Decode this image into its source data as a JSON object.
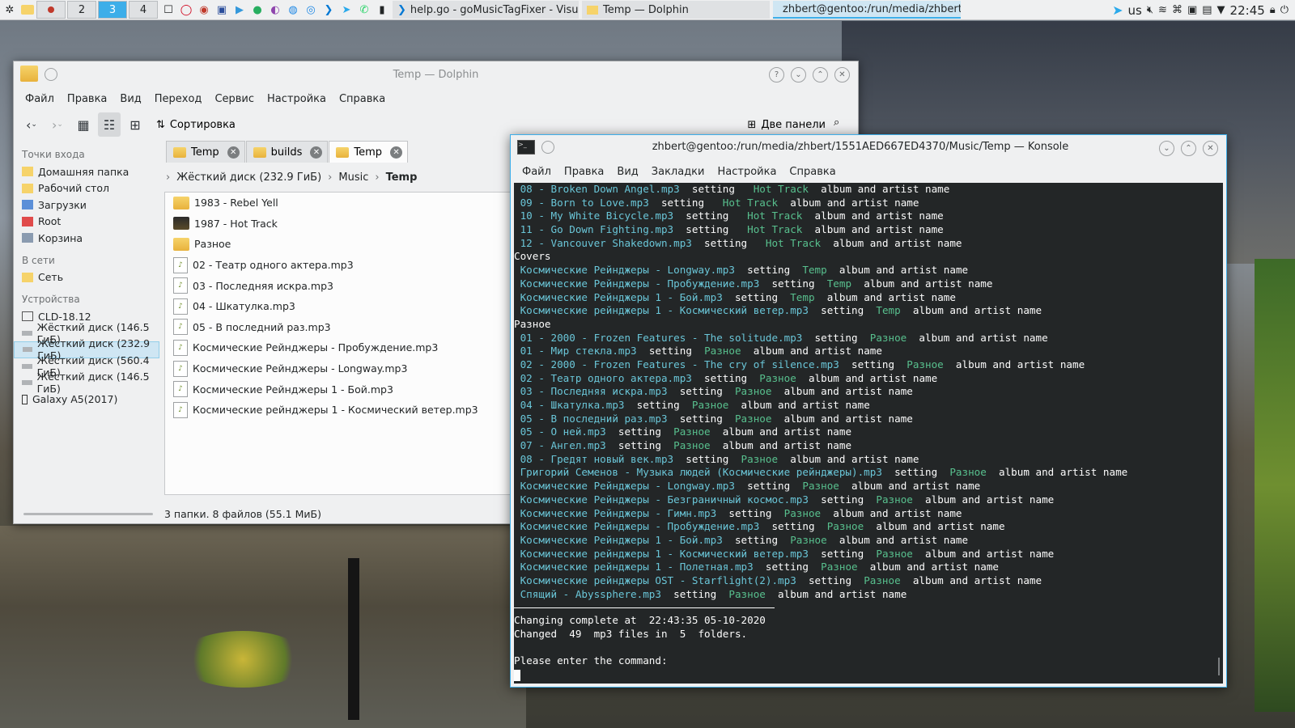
{
  "taskbar": {
    "pager": [
      "2",
      "3",
      "4"
    ],
    "tasks": [
      {
        "label": "help.go - goMusicTagFixer - Visual ...",
        "state": "dim"
      },
      {
        "label": "Temp — Dolphin",
        "state": "dim"
      },
      {
        "label": "zhbert@gentoo:/run/media/zhbert...",
        "state": "active"
      }
    ],
    "layout": "us",
    "clock": "22:45"
  },
  "dolphin": {
    "title": "Temp — Dolphin",
    "menu": [
      "Файл",
      "Правка",
      "Вид",
      "Переход",
      "Сервис",
      "Настройка",
      "Справка"
    ],
    "sort_label": "Сортировка",
    "panels_label": "Две панели",
    "places": {
      "entry_header": "Точки входа",
      "entries": [
        "Домашняя папка",
        "Рабочий стол",
        "Загрузки",
        "Root",
        "Корзина"
      ],
      "net_header": "В сети",
      "net": [
        "Сеть"
      ],
      "dev_header": "Устройства",
      "devices": [
        "CLD-18.12",
        "Жёсткий диск (146.5 ГиБ)",
        "Жёсткий диск (232.9 ГиБ)",
        "Жёсткий диск (560.4 ГиБ)",
        "Жёсткий диск (146.5 ГиБ)",
        "Galaxy A5(2017)"
      ]
    },
    "tabs": [
      "Temp",
      "builds",
      "Temp"
    ],
    "breadcrumb": [
      "Жёсткий диск (232.9 ГиБ)",
      "Music",
      "Temp"
    ],
    "files": [
      {
        "name": "1983 - Rebel Yell",
        "type": "folder"
      },
      {
        "name": "1987 - Hot Track",
        "type": "folder-cover"
      },
      {
        "name": "Разное",
        "type": "folder"
      },
      {
        "name": "02 - Театр одного актера.mp3",
        "type": "mp3"
      },
      {
        "name": "03 - Последняя искра.mp3",
        "type": "mp3"
      },
      {
        "name": "04 - Шкатулка.mp3",
        "type": "mp3"
      },
      {
        "name": "05 - В последний раз.mp3",
        "type": "mp3"
      },
      {
        "name": "Космические Рейнджеры - Пробуждение.mp3",
        "type": "mp3"
      },
      {
        "name": "Космические Рейнджеры - Longway.mp3",
        "type": "mp3"
      },
      {
        "name": "Космические Рейнджеры 1 - Бой.mp3",
        "type": "mp3"
      },
      {
        "name": "Космические рейнджеры 1 - Космический ветер.mp3",
        "type": "mp3"
      }
    ],
    "status": "3 папки. 8 файлов (55.1 МиБ)"
  },
  "konsole": {
    "title": "zhbert@gentoo:/run/media/zhbert/1551AED667ED4370/Music/Temp — Konsole",
    "menu": [
      "Файл",
      "Правка",
      "Вид",
      "Закладки",
      "Настройка",
      "Справка"
    ],
    "lines": [
      {
        "file": " 08 - Broken Down Angel.mp3",
        "mid": "  setting  ",
        "album": " Hot Track",
        "tail": "  album and artist name"
      },
      {
        "file": " 09 - Born to Love.mp3",
        "mid": "  setting  ",
        "album": " Hot Track",
        "tail": "  album and artist name"
      },
      {
        "file": " 10 - My White Bicycle.mp3",
        "mid": "  setting  ",
        "album": " Hot Track",
        "tail": "  album and artist name"
      },
      {
        "file": " 11 - Go Down Fighting.mp3",
        "mid": "  setting  ",
        "album": " Hot Track",
        "tail": "  album and artist name"
      },
      {
        "file": " 12 - Vancouver Shakedown.mp3",
        "mid": "  setting  ",
        "album": " Hot Track",
        "tail": "  album and artist name"
      },
      {
        "plain": "Covers"
      },
      {
        "file": " Космические Рейнджеры - Longway.mp3",
        "mid": "  setting  ",
        "album": "Temp",
        "tail": "  album and artist name"
      },
      {
        "file": " Космические Рейнджеры - Пробуждение.mp3",
        "mid": "  setting  ",
        "album": "Temp",
        "tail": "  album and artist name"
      },
      {
        "file": " Космические Рейнджеры 1 - Бой.mp3",
        "mid": "  setting  ",
        "album": "Temp",
        "tail": "  album and artist name"
      },
      {
        "file": " Космические рейнджеры 1 - Космический ветер.mp3",
        "mid": "  setting  ",
        "album": "Temp",
        "tail": "  album and artist name"
      },
      {
        "plain": "Разное"
      },
      {
        "file": " 01 - 2000 - Frozen Features - The solitude.mp3",
        "mid": "  setting  ",
        "album": "Разное",
        "tail": "  album and artist name"
      },
      {
        "file": " 01 - Мир стекла.mp3",
        "mid": "  setting  ",
        "album": "Разное",
        "tail": "  album and artist name"
      },
      {
        "file": " 02 - 2000 - Frozen Features - The cry of silence.mp3",
        "mid": "  setting  ",
        "album": "Разное",
        "tail": "  album and artist name"
      },
      {
        "file": " 02 - Театр одного актера.mp3",
        "mid": "  setting  ",
        "album": "Разное",
        "tail": "  album and artist name"
      },
      {
        "file": " 03 - Последняя искра.mp3",
        "mid": "  setting  ",
        "album": "Разное",
        "tail": "  album and artist name"
      },
      {
        "file": " 04 - Шкатулка.mp3",
        "mid": "  setting  ",
        "album": "Разное",
        "tail": "  album and artist name"
      },
      {
        "file": " 05 - В последний раз.mp3",
        "mid": "  setting  ",
        "album": "Разное",
        "tail": "  album and artist name"
      },
      {
        "file": " 05 - О ней.mp3",
        "mid": "  setting  ",
        "album": "Разное",
        "tail": "  album and artist name"
      },
      {
        "file": " 07 - Ангел.mp3",
        "mid": "  setting  ",
        "album": "Разное",
        "tail": "  album and artist name"
      },
      {
        "file": " 08 - Гредят новый век.mp3",
        "mid": "  setting  ",
        "album": "Разное",
        "tail": "  album and artist name"
      },
      {
        "file": " Григорий Семенов - Музыка людей (Космические рейнджеры).mp3",
        "mid": "  setting  ",
        "album": "Разное",
        "tail": "  album and artist name"
      },
      {
        "file": " Космические Рейнджеры - Longway.mp3",
        "mid": "  setting  ",
        "album": "Разное",
        "tail": "  album and artist name"
      },
      {
        "file": " Космические Рейнджеры - Безграничный космос.mp3",
        "mid": "  setting  ",
        "album": "Разное",
        "tail": "  album and artist name"
      },
      {
        "file": " Космические Рейнджеры - Гимн.mp3",
        "mid": "  setting  ",
        "album": "Разное",
        "tail": "  album and artist name"
      },
      {
        "file": " Космические Рейнджеры - Пробуждение.mp3",
        "mid": "  setting  ",
        "album": "Разное",
        "tail": "  album and artist name"
      },
      {
        "file": " Космические Рейнджеры 1 - Бой.mp3",
        "mid": "  setting  ",
        "album": "Разное",
        "tail": "  album and artist name"
      },
      {
        "file": " Космические рейнджеры 1 - Космический ветер.mp3",
        "mid": "  setting  ",
        "album": "Разное",
        "tail": "  album and artist name"
      },
      {
        "file": " Космические рейнджеры 1 - Полетная.mp3",
        "mid": "  setting  ",
        "album": "Разное",
        "tail": "  album and artist name"
      },
      {
        "file": " Космические рейнджеры OST - Starflight(2).mp3",
        "mid": "  setting  ",
        "album": "Разное",
        "tail": "  album and artist name"
      },
      {
        "file": " Спящий - Abyssphere.mp3",
        "mid": "  setting  ",
        "album": "Разное",
        "tail": "  album and artist name"
      }
    ],
    "summary1": "Changing complete at  22:43:35 05-10-2020",
    "summary2": "Changed  49  mp3 files in  5  folders.",
    "prompt": "Please enter the command:"
  },
  "colors": {
    "accent": "#3daee9",
    "term_bg": "#232627",
    "term_file": "#6ac6d8",
    "term_album": "#58c08e"
  }
}
